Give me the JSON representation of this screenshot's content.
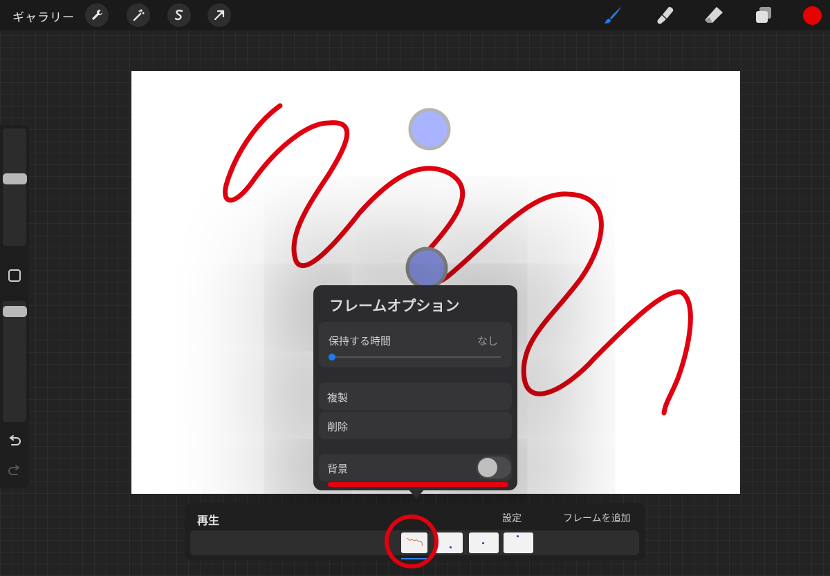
{
  "topbar": {
    "gallery_label": "ギャラリー",
    "tools_left": [
      "wrench-icon",
      "magic-wand-icon",
      "selection-icon",
      "move-arrow-icon"
    ],
    "tools_right": [
      "brush-icon",
      "smudge-icon",
      "eraser-icon",
      "layers-icon"
    ],
    "current_color": "#e60000",
    "active_tool_color": "#1e7cf2"
  },
  "sidebar": {
    "brush_size_level": 0.45,
    "opacity_level": 0.0,
    "icons": [
      "modify-square-icon",
      "undo-icon",
      "redo-icon"
    ]
  },
  "frame_options": {
    "title": "フレームオプション",
    "hold_label": "保持する時間",
    "hold_value": "なし",
    "hold_level": 0,
    "duplicate_label": "複製",
    "delete_label": "削除",
    "background_label": "背景",
    "background_enabled": false
  },
  "timeline": {
    "play_label": "再生",
    "settings_label": "設定",
    "add_frame_label": "フレームを追加",
    "frame_count": 4,
    "selected_frame": 1
  },
  "colors": {
    "stroke": "#e00010",
    "onion_dot": "#a8b4ff",
    "toggle_off": "#4a4a4c"
  }
}
